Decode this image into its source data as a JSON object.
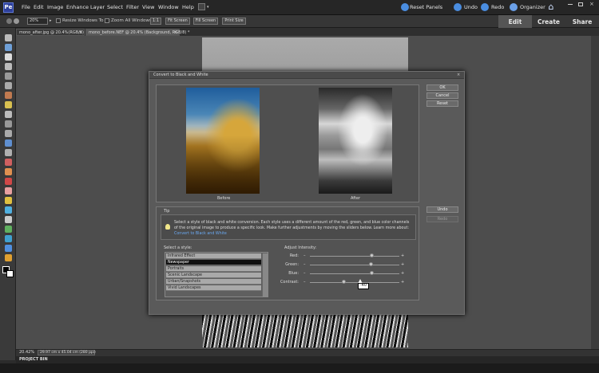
{
  "menu": {
    "items": [
      "File",
      "Edit",
      "Image",
      "Enhance",
      "Layer",
      "Select",
      "Filter",
      "View",
      "Window",
      "Help"
    ],
    "right": {
      "reset_panels": "Reset Panels",
      "undo": "Undo",
      "redo": "Redo",
      "organizer": "Organizer"
    }
  },
  "modes": {
    "edit": "Edit",
    "create": "Create",
    "share": "Share"
  },
  "options": {
    "zoom": "20%",
    "resize_windows": "Resize Windows To Fit",
    "zoom_all": "Zoom All Windows",
    "btn_1to1": "1:1",
    "btn_fit": "Fit Screen",
    "btn_fill": "Fill Screen",
    "btn_print": "Print Size"
  },
  "doc_tabs": {
    "tab1": "mono_after.jpg @ 20.4%(RGB/8)",
    "tab1_close": "×",
    "tab2": "mono_before.NEF @ 20.4% (Background, RGB/8) *",
    "tab2_close": "×"
  },
  "dialog": {
    "title": "Convert to Black and White",
    "close": "×",
    "before": "Before",
    "after": "After",
    "ok": "OK",
    "cancel": "Cancel",
    "reset": "Reset",
    "undo": "Undo",
    "redo": "Redo",
    "tip_heading": "Tip",
    "tip_text": "Select a style of black and white conversion. Each style uses a different amount of the red, green, and blue color channels of the original image to produce a specific look. Make further adjustments by moving the sliders below. Learn more about:",
    "tip_link": "Convert to Black and White",
    "select_style": "Select a style:",
    "styles": [
      "Infrared Effect",
      "Newspaper",
      "Portraits",
      "Scenic Landscape",
      "Urban/Snapshots",
      "Vivid Landscapes"
    ],
    "selected_style_index": 1,
    "adjust_intensity": "Adjust Intensity:",
    "sliders": [
      {
        "label": "Red:",
        "minus": "–",
        "plus": "+",
        "value": 0.7
      },
      {
        "label": "Green:",
        "minus": "–",
        "plus": "+",
        "value": 0.69
      },
      {
        "label": "Blue:",
        "minus": "–",
        "plus": "+",
        "value": 0.7
      },
      {
        "label": "Contrast:",
        "minus": "–",
        "plus": "+",
        "value": 0.38
      }
    ],
    "tooltip": "-40"
  },
  "status": {
    "zoom": "20.42%",
    "doc_size": "29.97 cm x 45.04 cm (280 ppi)",
    "project_bin": "PROJECT BIN"
  },
  "colors": {
    "accent_blue": "#2d3f9a",
    "link_blue": "#6aa8f0"
  }
}
